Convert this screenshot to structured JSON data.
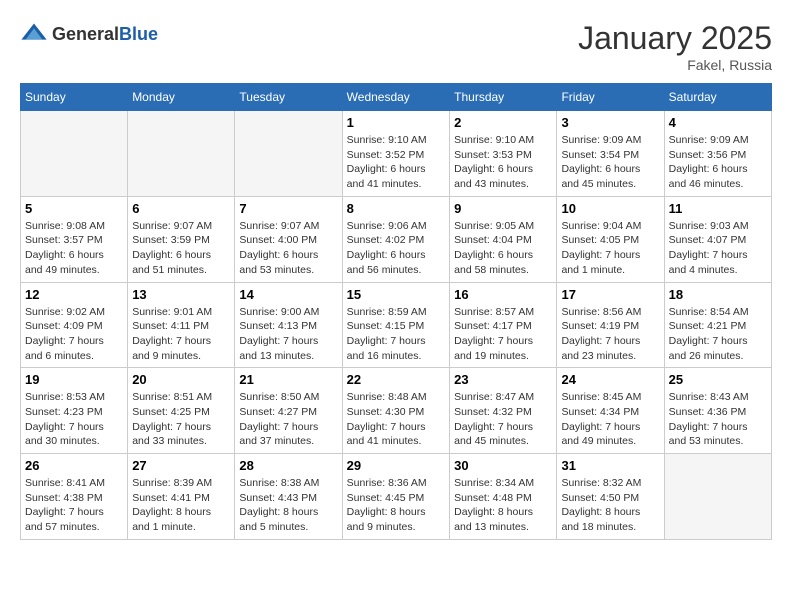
{
  "header": {
    "logo": {
      "general": "General",
      "blue": "Blue"
    },
    "title": "January 2025",
    "location": "Fakel, Russia"
  },
  "weekdays": [
    "Sunday",
    "Monday",
    "Tuesday",
    "Wednesday",
    "Thursday",
    "Friday",
    "Saturday"
  ],
  "weeks": [
    [
      {
        "day": "",
        "info": ""
      },
      {
        "day": "",
        "info": ""
      },
      {
        "day": "",
        "info": ""
      },
      {
        "day": "1",
        "info": "Sunrise: 9:10 AM\nSunset: 3:52 PM\nDaylight: 6 hours and 41 minutes."
      },
      {
        "day": "2",
        "info": "Sunrise: 9:10 AM\nSunset: 3:53 PM\nDaylight: 6 hours and 43 minutes."
      },
      {
        "day": "3",
        "info": "Sunrise: 9:09 AM\nSunset: 3:54 PM\nDaylight: 6 hours and 45 minutes."
      },
      {
        "day": "4",
        "info": "Sunrise: 9:09 AM\nSunset: 3:56 PM\nDaylight: 6 hours and 46 minutes."
      }
    ],
    [
      {
        "day": "5",
        "info": "Sunrise: 9:08 AM\nSunset: 3:57 PM\nDaylight: 6 hours and 49 minutes."
      },
      {
        "day": "6",
        "info": "Sunrise: 9:07 AM\nSunset: 3:59 PM\nDaylight: 6 hours and 51 minutes."
      },
      {
        "day": "7",
        "info": "Sunrise: 9:07 AM\nSunset: 4:00 PM\nDaylight: 6 hours and 53 minutes."
      },
      {
        "day": "8",
        "info": "Sunrise: 9:06 AM\nSunset: 4:02 PM\nDaylight: 6 hours and 56 minutes."
      },
      {
        "day": "9",
        "info": "Sunrise: 9:05 AM\nSunset: 4:04 PM\nDaylight: 6 hours and 58 minutes."
      },
      {
        "day": "10",
        "info": "Sunrise: 9:04 AM\nSunset: 4:05 PM\nDaylight: 7 hours and 1 minute."
      },
      {
        "day": "11",
        "info": "Sunrise: 9:03 AM\nSunset: 4:07 PM\nDaylight: 7 hours and 4 minutes."
      }
    ],
    [
      {
        "day": "12",
        "info": "Sunrise: 9:02 AM\nSunset: 4:09 PM\nDaylight: 7 hours and 6 minutes."
      },
      {
        "day": "13",
        "info": "Sunrise: 9:01 AM\nSunset: 4:11 PM\nDaylight: 7 hours and 9 minutes."
      },
      {
        "day": "14",
        "info": "Sunrise: 9:00 AM\nSunset: 4:13 PM\nDaylight: 7 hours and 13 minutes."
      },
      {
        "day": "15",
        "info": "Sunrise: 8:59 AM\nSunset: 4:15 PM\nDaylight: 7 hours and 16 minutes."
      },
      {
        "day": "16",
        "info": "Sunrise: 8:57 AM\nSunset: 4:17 PM\nDaylight: 7 hours and 19 minutes."
      },
      {
        "day": "17",
        "info": "Sunrise: 8:56 AM\nSunset: 4:19 PM\nDaylight: 7 hours and 23 minutes."
      },
      {
        "day": "18",
        "info": "Sunrise: 8:54 AM\nSunset: 4:21 PM\nDaylight: 7 hours and 26 minutes."
      }
    ],
    [
      {
        "day": "19",
        "info": "Sunrise: 8:53 AM\nSunset: 4:23 PM\nDaylight: 7 hours and 30 minutes."
      },
      {
        "day": "20",
        "info": "Sunrise: 8:51 AM\nSunset: 4:25 PM\nDaylight: 7 hours and 33 minutes."
      },
      {
        "day": "21",
        "info": "Sunrise: 8:50 AM\nSunset: 4:27 PM\nDaylight: 7 hours and 37 minutes."
      },
      {
        "day": "22",
        "info": "Sunrise: 8:48 AM\nSunset: 4:30 PM\nDaylight: 7 hours and 41 minutes."
      },
      {
        "day": "23",
        "info": "Sunrise: 8:47 AM\nSunset: 4:32 PM\nDaylight: 7 hours and 45 minutes."
      },
      {
        "day": "24",
        "info": "Sunrise: 8:45 AM\nSunset: 4:34 PM\nDaylight: 7 hours and 49 minutes."
      },
      {
        "day": "25",
        "info": "Sunrise: 8:43 AM\nSunset: 4:36 PM\nDaylight: 7 hours and 53 minutes."
      }
    ],
    [
      {
        "day": "26",
        "info": "Sunrise: 8:41 AM\nSunset: 4:38 PM\nDaylight: 7 hours and 57 minutes."
      },
      {
        "day": "27",
        "info": "Sunrise: 8:39 AM\nSunset: 4:41 PM\nDaylight: 8 hours and 1 minute."
      },
      {
        "day": "28",
        "info": "Sunrise: 8:38 AM\nSunset: 4:43 PM\nDaylight: 8 hours and 5 minutes."
      },
      {
        "day": "29",
        "info": "Sunrise: 8:36 AM\nSunset: 4:45 PM\nDaylight: 8 hours and 9 minutes."
      },
      {
        "day": "30",
        "info": "Sunrise: 8:34 AM\nSunset: 4:48 PM\nDaylight: 8 hours and 13 minutes."
      },
      {
        "day": "31",
        "info": "Sunrise: 8:32 AM\nSunset: 4:50 PM\nDaylight: 8 hours and 18 minutes."
      },
      {
        "day": "",
        "info": ""
      }
    ]
  ]
}
